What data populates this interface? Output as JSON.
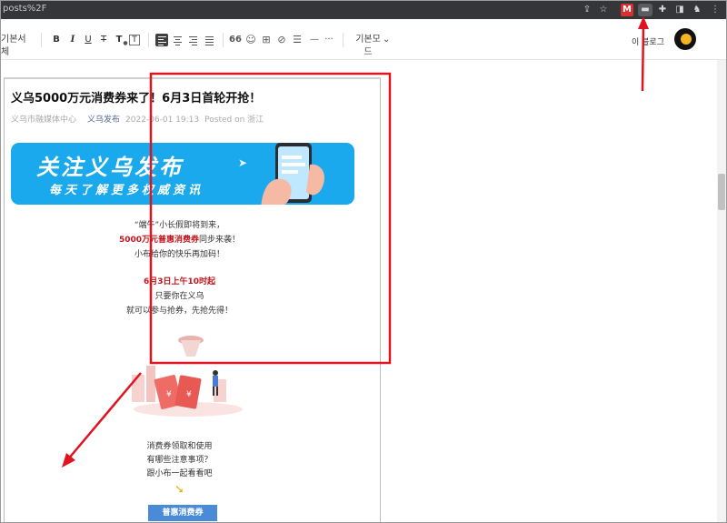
{
  "browser": {
    "url_fragment": "posts%2F"
  },
  "toolbar": {
    "font_style": "기본서체",
    "bold": "B",
    "italic": "I",
    "underline": "U",
    "strike": "T",
    "text_color": "T",
    "text_bg": "T",
    "quote": "66",
    "mode": "기본모드",
    "mode_chevron": "⌄",
    "user_name": "이 블로그",
    "more": "···"
  },
  "article": {
    "title": "义乌5000万元消费券来了！6月3日首轮开抢！",
    "source": "义乌市融媒体中心",
    "account": "义乌发布",
    "datetime": "2022-06-01 19:13",
    "posted_on": "Posted on 浙江",
    "banner_line1": "关注义乌发布",
    "banner_line2": "每天了解更多权威资讯",
    "p1": "“端午”小长假即将到来，",
    "p2_red": "5000万元普惠消费券",
    "p2_rest": "同步来袭！",
    "p3": "小布给你的快乐再加码！",
    "p4_red": "6月3日上午10时起",
    "p5": "只要你在义乌",
    "p6": "就可以参与抢券，先抢先得！",
    "q1": "消费券领取和使用",
    "q2": "有哪些注意事项？",
    "q3": "跟小布一起看看吧",
    "pill": "普惠消费券"
  },
  "colors": {
    "annotation": "#e0141e",
    "banner": "#19a9ec",
    "accent_red": "#c0181f",
    "pill": "#4a8bd8"
  }
}
